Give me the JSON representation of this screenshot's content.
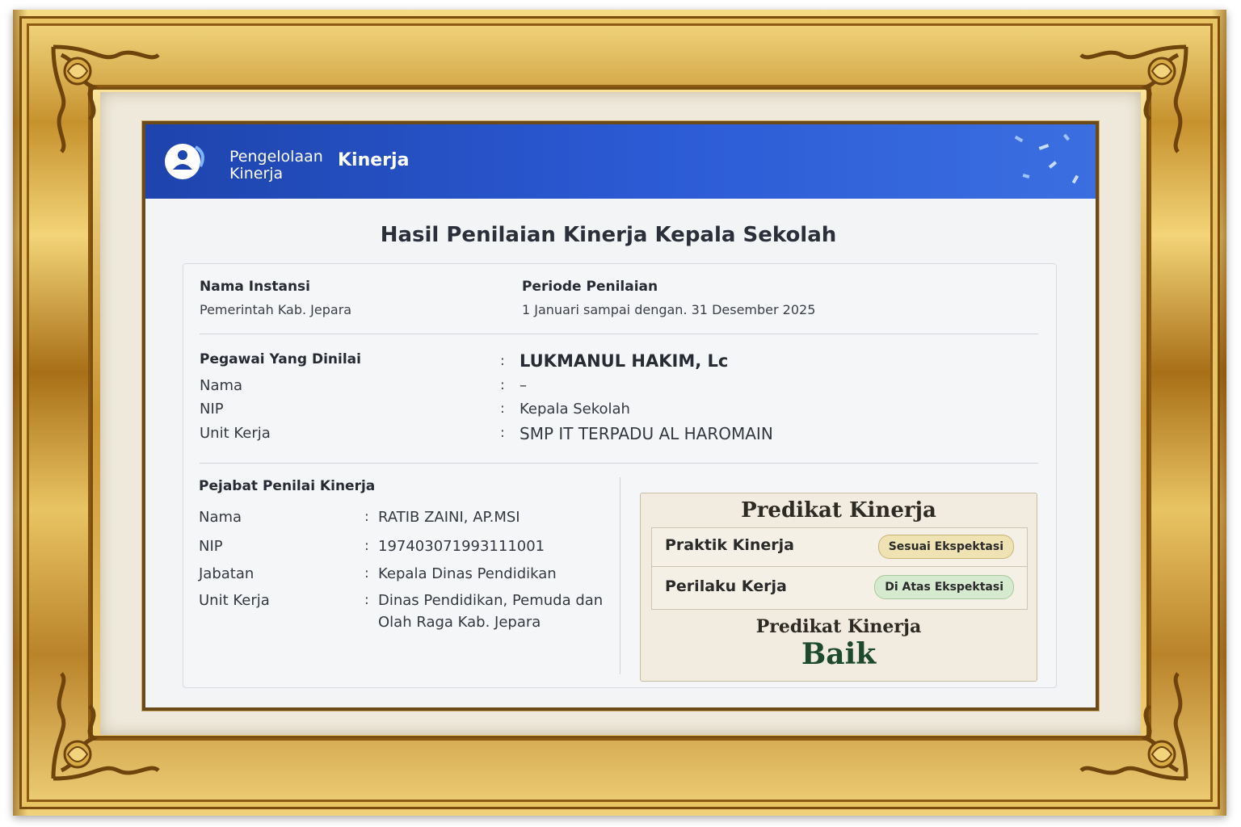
{
  "header": {
    "brand_line1": "Pengelolaan",
    "brand_line2": "Kinerja",
    "brand_bold": "Kinerja",
    "color": "#2c5bd6"
  },
  "title": "Hasil Penilaian Kinerja Kepala Sekolah",
  "instansi": {
    "label": "Nama Instansi",
    "value": "Pemerintah Kab. Jepara"
  },
  "periode": {
    "label": "Periode Penilaian",
    "value": "1 Januari sampai dengan. 31 Desember 2025"
  },
  "pegawai": {
    "heading": "Pegawai Yang Dinilai",
    "heading_value": "LUKMANUL HAKIM, Lc",
    "rows": [
      {
        "label": "Nama",
        "value": "–"
      },
      {
        "label": "NIP",
        "value": "Kepala Sekolah"
      },
      {
        "label": "Unit Kerja",
        "value": "SMP IT TERPADU AL HAROMAIN"
      }
    ]
  },
  "pejabat": {
    "heading": "Pejabat Penilai Kinerja",
    "rows": [
      {
        "label": "Nama",
        "value": "RATIB ZAINI, AP.MSI"
      },
      {
        "label": "NIP",
        "value": "197403071993111001"
      },
      {
        "label": "Jabatan",
        "value": "Kepala Dinas Pendidikan"
      },
      {
        "label": "Unit Kerja",
        "value": "Dinas Pendidikan, Pemuda dan",
        "value2": "Olah Raga Kab. Jepara"
      }
    ]
  },
  "predikat": {
    "title": "Predikat Kinerja",
    "items": [
      {
        "label": "Praktik Kinerja",
        "badge": "Sesuai Ekspektasi",
        "color": "#f0e3b3"
      },
      {
        "label": "Perilaku Kerja",
        "badge": "Di Atas Ekspektasi",
        "color": "#d6ead0"
      }
    ],
    "summary_label": "Predikat Kinerja",
    "summary_value": "Baik"
  },
  "colon": ":"
}
